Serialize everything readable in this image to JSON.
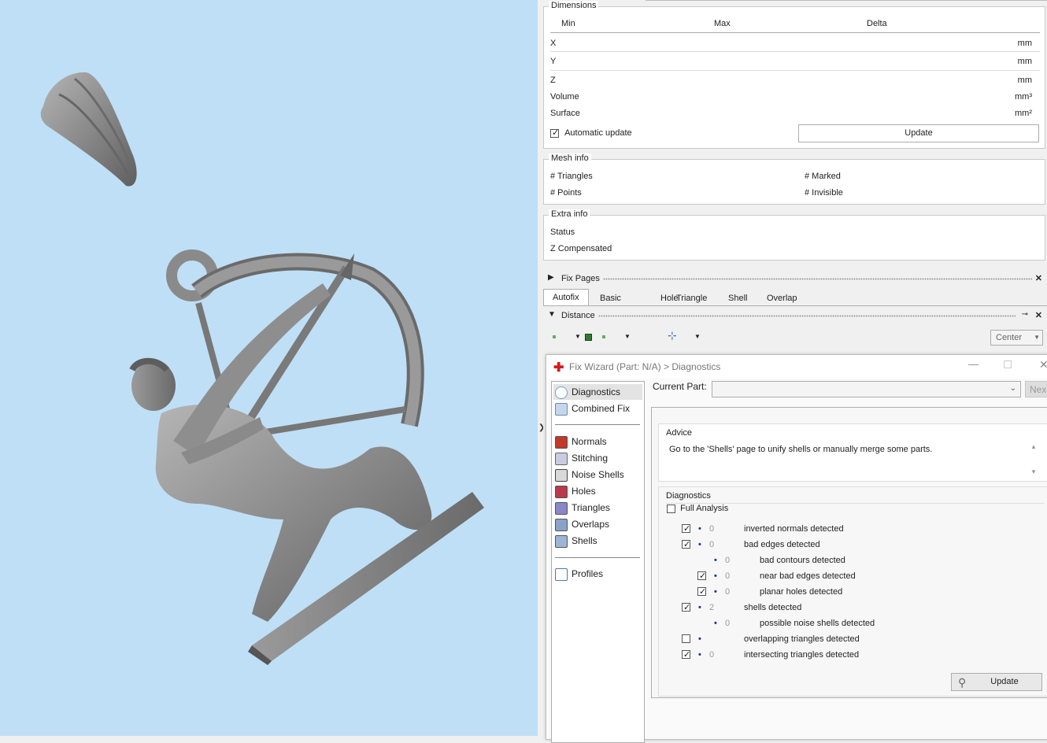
{
  "dimensions": {
    "title": "Dimensions",
    "col_min": "Min",
    "col_max": "Max",
    "col_delta": "Delta",
    "rows": [
      {
        "label": "X",
        "unit": "mm"
      },
      {
        "label": "Y",
        "unit": "mm"
      },
      {
        "label": "Z",
        "unit": "mm"
      },
      {
        "label": "Volume",
        "unit": "mm³"
      },
      {
        "label": "Surface",
        "unit": "mm²"
      }
    ],
    "auto_update_label": "Automatic update",
    "update_label": "Update"
  },
  "mesh_info": {
    "title": "Mesh info",
    "triangles": "# Triangles",
    "points": "# Points",
    "marked": "# Marked",
    "invisible": "# Invisible"
  },
  "extra_info": {
    "title": "Extra info",
    "status": "Status",
    "z_comp": "Z Compensated"
  },
  "fix_pages": {
    "title": "Fix Pages",
    "tabs": [
      "Autofix",
      "Basic",
      "Hole",
      "Triangle",
      "Shell",
      "Overlap"
    ]
  },
  "distance": {
    "title": "Distance",
    "center": "Center"
  },
  "wizard": {
    "title": "Fix Wizard (Part: N/A) > Diagnostics",
    "current_part_label": "Current Part:",
    "next_label": "Nex",
    "nav": [
      {
        "label": "Diagnostics",
        "icon": "magnifier-icon"
      },
      {
        "label": "Combined Fix",
        "icon": "combined-fix-icon"
      },
      {
        "label": "Normals",
        "icon": "normals-icon"
      },
      {
        "label": "Stitching",
        "icon": "stitching-icon"
      },
      {
        "label": "Noise Shells",
        "icon": "noise-shells-icon"
      },
      {
        "label": "Holes",
        "icon": "holes-icon"
      },
      {
        "label": "Triangles",
        "icon": "triangles-icon"
      },
      {
        "label": "Overlaps",
        "icon": "overlaps-icon"
      },
      {
        "label": "Shells",
        "icon": "shells-icon"
      },
      {
        "label": "Profiles",
        "icon": "profiles-icon"
      }
    ],
    "advice_title": "Advice",
    "advice_text": "Go to the 'Shells' page to unify shells or manually merge some parts.",
    "diagnostics_title": "Diagnostics",
    "full_analysis": "Full Analysis",
    "rows": [
      {
        "checked": true,
        "count": "0",
        "label": "inverted normals detected",
        "level": 0,
        "has_check": true
      },
      {
        "checked": true,
        "count": "0",
        "label": "bad edges detected",
        "level": 0,
        "has_check": true
      },
      {
        "checked": false,
        "count": "0",
        "label": "bad contours detected",
        "level": 1,
        "has_check": false
      },
      {
        "checked": true,
        "count": "0",
        "label": "near bad edges detected",
        "level": 1,
        "has_check": true
      },
      {
        "checked": true,
        "count": "0",
        "label": "planar holes detected",
        "level": 1,
        "has_check": true
      },
      {
        "checked": true,
        "count": "2",
        "label": "shells detected",
        "level": 0,
        "has_check": true
      },
      {
        "checked": false,
        "count": "0",
        "label": "possible noise shells detected",
        "level": 1,
        "has_check": false
      },
      {
        "checked": false,
        "count": "",
        "label": "overlapping triangles detected",
        "level": 0,
        "has_check": true
      },
      {
        "checked": true,
        "count": "0",
        "label": "intersecting triangles detected",
        "level": 0,
        "has_check": true
      }
    ],
    "update_label": "Update"
  },
  "colors": {
    "viewport_bg": "#bfdff6",
    "model": "#8c8c8c",
    "accent": "#1e3a9a"
  }
}
